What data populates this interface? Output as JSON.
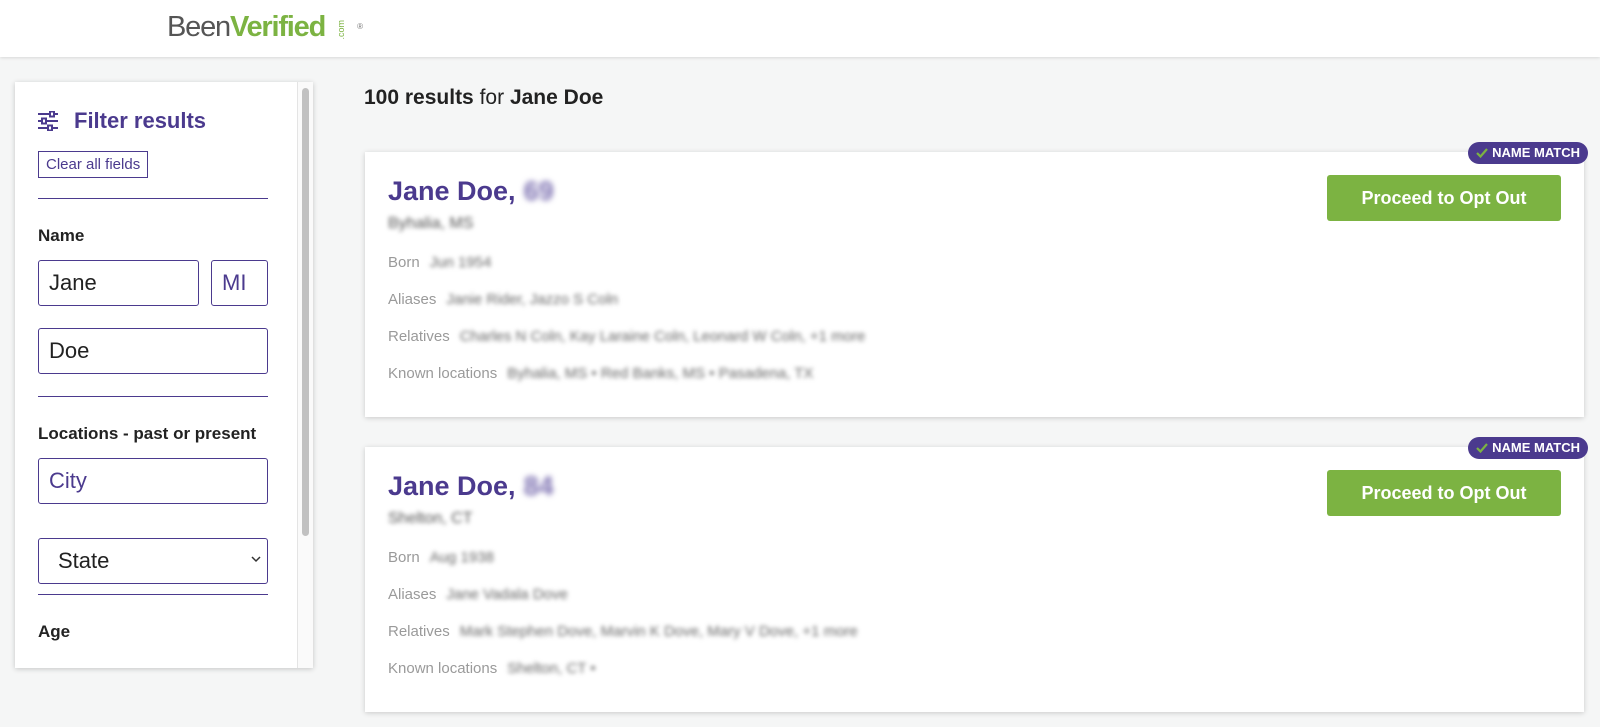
{
  "header": {
    "logo_been": "Been",
    "logo_verified": "Verified",
    "logo_com": ".com",
    "logo_reg": "®"
  },
  "sidebar": {
    "title": "Filter results",
    "clear_label": "Clear all fields",
    "name_label": "Name",
    "first_name_value": "Jane",
    "middle_initial_placeholder": "MI",
    "last_name_value": "Doe",
    "locations_label": "Locations - past or present",
    "city_placeholder": "City",
    "state_value": "State",
    "age_label": "Age"
  },
  "results": {
    "count": "100 results",
    "for_text": "for",
    "query": "Jane Doe"
  },
  "labels": {
    "born": "Born",
    "aliases": "Aliases",
    "relatives": "Relatives",
    "known_locations": "Known locations",
    "opt_out": "Proceed to Opt Out",
    "badge": "NAME MATCH"
  },
  "cards": [
    {
      "name": "Jane Doe,",
      "age": "69",
      "location": "Byhalia, MS",
      "born": "Jun 1954",
      "aliases": "Janie Rider, Jazzo S Coln",
      "relatives": "Charles N Coln, Kay Laraine Coln, Leonard W Coln, +1 more",
      "known_locations": "Byhalia, MS • Red Banks, MS • Pasadena, TX"
    },
    {
      "name": "Jane Doe,",
      "age": "84",
      "location": "Shelton, CT",
      "born": "Aug 1938",
      "aliases": "Jane Vadala Dove",
      "relatives": "Mark Stephen Dove, Marvin K Dove, Mary V Dove, +1 more",
      "known_locations": "Shelton, CT •"
    }
  ],
  "colors": {
    "brand_purple": "#4b3a8e",
    "brand_green": "#7cb342"
  }
}
